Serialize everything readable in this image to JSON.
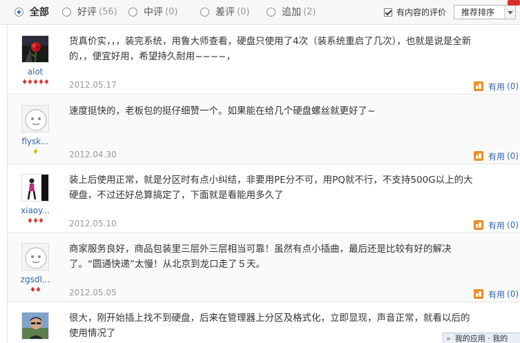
{
  "filters": [
    {
      "label": "全部",
      "count": "",
      "selected": true
    },
    {
      "label": "好评",
      "count": "(56)",
      "selected": false
    },
    {
      "label": "中评",
      "count": "(0)",
      "selected": false
    },
    {
      "label": "差评",
      "count": "(0)",
      "selected": false
    },
    {
      "label": "追加",
      "count": "(2)",
      "selected": false
    }
  ],
  "content_only": {
    "label": "有内容的评价",
    "checked": true
  },
  "sort": {
    "selected": "推荐排序"
  },
  "reviews": [
    {
      "user": "alot",
      "stars": "♦♦♦♦♦",
      "star_color": "red",
      "avatar": "rose-photo",
      "text": "货真价实，，，装完系统，用鲁大师查看，硬盘只使用了4次（装系统重启了几次），也就是说是全新的，，便宜好用，希望持久耐用~~~~，",
      "date": "2012.05.17",
      "useful_label": "有用",
      "useful_count": "(0)"
    },
    {
      "user": "flysk...",
      "stars": "♦",
      "star_color": "gold",
      "avatar": "default-avatar",
      "text": "速度挺快的，老板包的挺仔细赞一个。如果能在给几个硬盘螺丝就更好了~",
      "date": "2012.04.30",
      "useful_label": "有用",
      "useful_count": "(0)"
    },
    {
      "user": "xiaoy...",
      "stars": "♦♦♦",
      "star_color": "red",
      "avatar": "person-photo",
      "text": "装上后使用正常，就是分区时有点小纠结，非要用PE分不可，用PQ就不行，不支持500G以上的大硬盘，不过还好总算搞定了，下面就是看能用多久了",
      "date": "2012.05.10",
      "useful_label": "有用",
      "useful_count": "(0)"
    },
    {
      "user": "zgsdl...",
      "stars": "♦♦",
      "star_color": "red",
      "avatar": "default-avatar",
      "text": "商家服务良好，商品包装里三层外三层相当可靠！虽然有点小插曲，最后还是比较有好的解决了。“圆通快递”太慢！从北京到龙口走了５天。",
      "date": "2012.05.05",
      "useful_label": "有用",
      "useful_count": "(0)"
    },
    {
      "user": "",
      "stars": "",
      "star_color": "red",
      "avatar": "man-photo",
      "text": "很大，刚开始插上找不到硬盘，后来在管理器上分区及格式化，立即显现，声音正常，就看以后的使用情况了",
      "date": "",
      "useful_label": "",
      "useful_count": ""
    }
  ],
  "overlay": {
    "label": "我的应用 · 我的"
  }
}
